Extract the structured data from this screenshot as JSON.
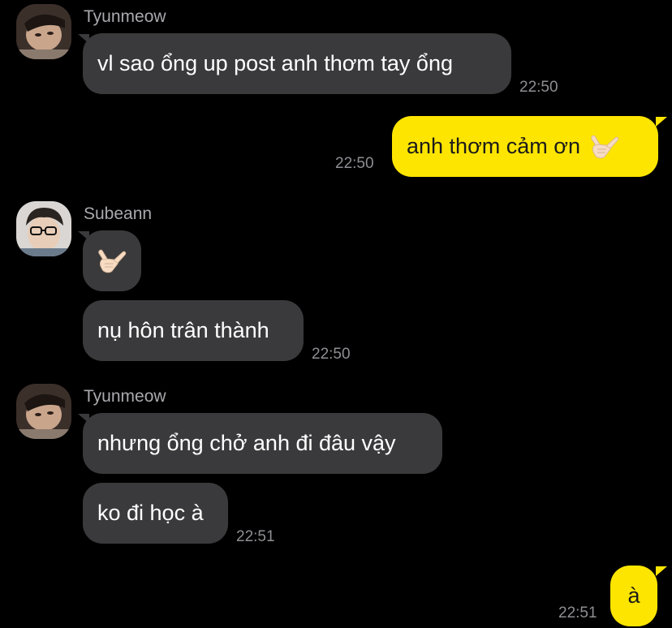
{
  "chat": {
    "groups": [
      {
        "sender": "Tyunmeow",
        "messages": [
          {
            "text": "vl sao ổng up post anh thơm tay ổng",
            "time": "22:50"
          }
        ]
      },
      {
        "outgoing": true,
        "messages": [
          {
            "text": "anh thơm cảm ơn",
            "emoji": "call-me-hand-emoji",
            "time": "22:50"
          }
        ]
      },
      {
        "sender": "Subeann",
        "messages": [
          {
            "emoji": "call-me-hand-emoji"
          },
          {
            "text": "nụ hôn trân thành",
            "time": "22:50"
          }
        ]
      },
      {
        "sender": "Tyunmeow",
        "messages": [
          {
            "text": "nhưng ổng chở anh đi đâu vậy"
          },
          {
            "text": "ko đi học à",
            "time": "22:51"
          }
        ]
      },
      {
        "outgoing": true,
        "messages": [
          {
            "text": "à",
            "time": "22:51"
          }
        ]
      }
    ]
  },
  "colors": {
    "background": "#000000",
    "incoming_bubble": "#3a3a3c",
    "outgoing_bubble": "#fee500",
    "timestamp": "#8e8e93",
    "sender_name": "#a9a9ae"
  }
}
